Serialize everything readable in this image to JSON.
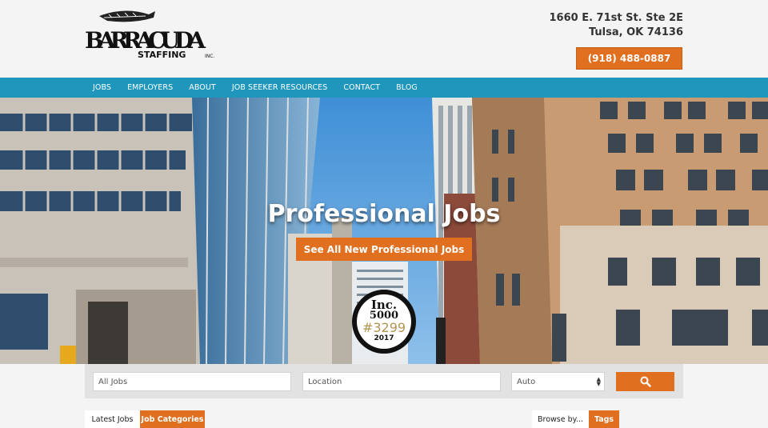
{
  "logo": {
    "brand": "BARRACUDA",
    "sub": "STAFFING",
    "suffix": "INC."
  },
  "address": {
    "line1": "1660 E. 71st St. Ste 2E",
    "line2": "Tulsa, OK 74136"
  },
  "phone": "(918) 488-0887",
  "nav": [
    "JOBS",
    "EMPLOYERS",
    "ABOUT",
    "JOB SEEKER RESOURCES",
    "CONTACT",
    "BLOG"
  ],
  "hero": {
    "title": "Professional Jobs",
    "button": "See All New Professional Jobs"
  },
  "badge": {
    "brand": "Inc.",
    "list": "5000",
    "rank": "#3299",
    "year": "2017"
  },
  "search": {
    "keyword_placeholder": "All Jobs",
    "location_placeholder": "Location",
    "select_value": "Auto"
  },
  "tabs": {
    "latest": "Latest Jobs",
    "categories": "Job Categories",
    "browse": "Browse by...",
    "tags": "Tags"
  },
  "colors": {
    "accent": "#e07020",
    "nav": "#1f97bd"
  },
  "icons": {
    "search": "search-icon",
    "logo_fish": "barracuda-fish-icon"
  }
}
